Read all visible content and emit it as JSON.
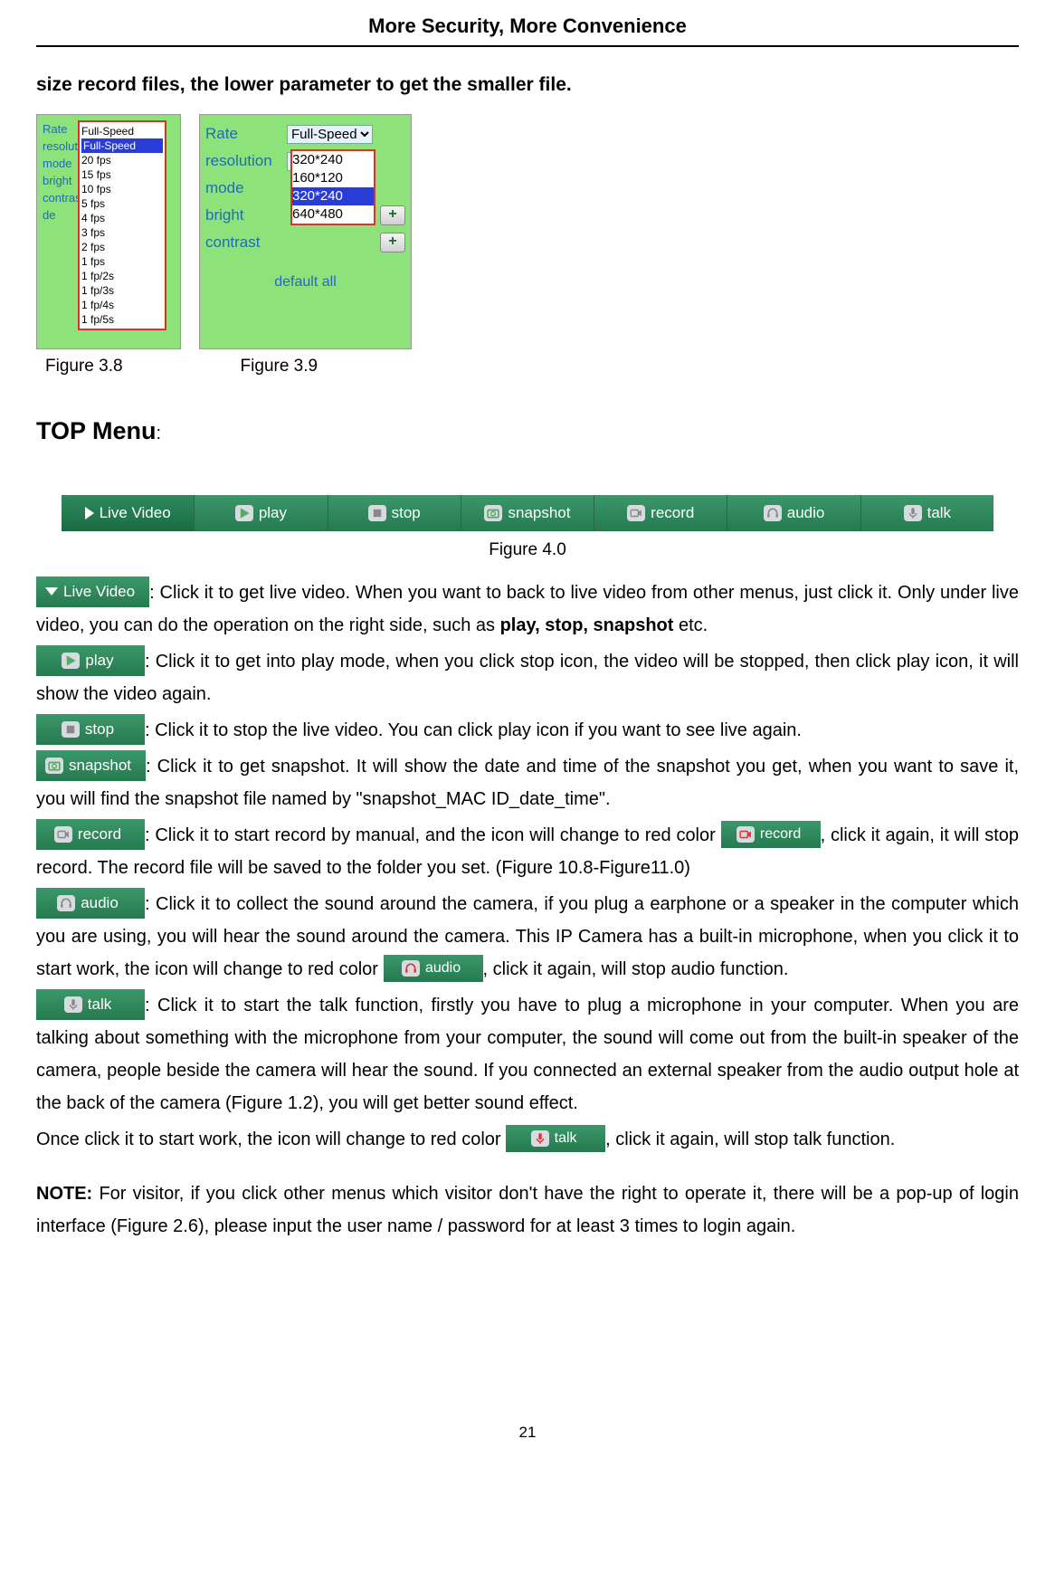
{
  "header": {
    "title": "More Security, More Convenience"
  },
  "intro": "size record files, the lower parameter to get the smaller file.",
  "fig38": {
    "labels": [
      "Rate",
      "resolution",
      "mode",
      "bright",
      "contrast",
      "de"
    ],
    "options": [
      "Full-Speed",
      "Full-Speed",
      "20 fps",
      "15 fps",
      "10 fps",
      "5 fps",
      "4 fps",
      "3 fps",
      "2 fps",
      "1 fps",
      "1 fp/2s",
      "1 fp/3s",
      "1 fp/4s",
      "1 fp/5s"
    ]
  },
  "fig39": {
    "rows": [
      "Rate",
      "resolution",
      "mode",
      "bright",
      "contrast"
    ],
    "rate_val": "Full-Speed",
    "res_options": [
      "320*240",
      "160*120",
      "320*240",
      "640*480"
    ],
    "default": "default all"
  },
  "captions": {
    "c38": "Figure 3.8",
    "c39": "Figure 3.9"
  },
  "section": {
    "title": "TOP Menu",
    "colon": ":"
  },
  "menubar": [
    "Live Video",
    "play",
    "stop",
    "snapshot",
    "record",
    "audio",
    "talk"
  ],
  "fig40": "Figure 4.0",
  "buttons": {
    "live": "Live Video",
    "play": "play",
    "stop": "stop",
    "snapshot": "snapshot",
    "record": "record",
    "audio": "audio",
    "talk": "talk"
  },
  "text": {
    "live1": ": Click it to get live video. When you want to back to live video from other menus, just click it. Only under live video, you can do the operation on the right side, such as ",
    "live_bold": "play, stop, snapshot",
    "live2": " etc.",
    "play": ": Click it to get into play mode, when you click stop icon, the video will be stopped, then click play icon, it will show the video again.",
    "stop": ": Click it to stop the live video. You can click play icon if you want to see live again.",
    "snap": ": Click it to get snapshot. It will show the date and time of the snapshot you get, when you want to save it, you will find the snapshot file named by \"snapshot_MAC ID_date_time\".",
    "rec1": ": Click it to start record by manual, and the icon will change to red color",
    "rec2": ", click it again, it will stop record. The record file will be saved to the folder you set. (Figure 10.8-Figure11.0)",
    "aud1": ": Click it to collect the sound around the camera, if you plug a earphone or a speaker in the computer which you are using, you will hear the sound around the camera. This IP Camera has a built-in microphone, when you click it to start work, the icon will change to red color",
    "aud2": ", click it again, will stop audio function.",
    "talk1": ": Click it to start the talk function, firstly you have to plug a microphone in your computer. When you are talking about something with the microphone from your computer, the sound will come out from the built-in speaker of the camera, people beside the camera will hear the sound. If you connected an external speaker from the audio output hole at the back of the camera (Figure 1.2), you will get better sound effect.",
    "talk2a": "Once click it to start work, the icon will change to red color",
    "talk2b": ", click it again, will stop talk function.",
    "note_b": "NOTE:",
    "note": " For visitor, if you click other menus which visitor don't have the right to operate it, there will be a pop-up of login interface (Figure 2.6), please input the user name / password for at least 3 times to login again."
  },
  "page_num": "21"
}
